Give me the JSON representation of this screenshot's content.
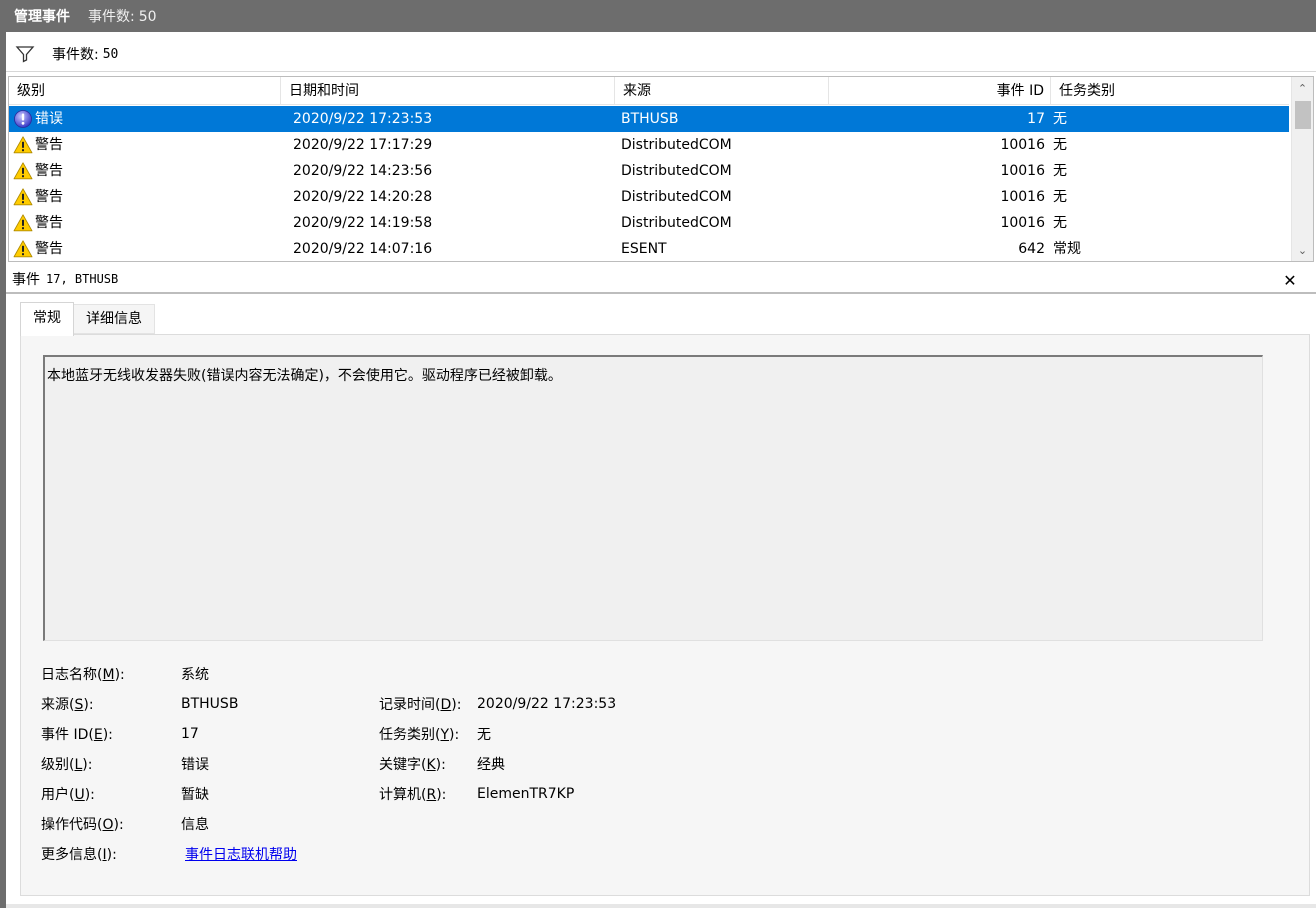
{
  "title": {
    "main": "管理事件",
    "count_label": "事件数:",
    "count_value": "50"
  },
  "filter": {
    "count_label": "事件数:",
    "count_value": "50"
  },
  "columns": {
    "level": "级别",
    "datetime": "日期和时间",
    "source": "来源",
    "event_id": "事件 ID",
    "task": "任务类别"
  },
  "events": [
    {
      "level": "错误",
      "icon": "error-icon",
      "datetime": "2020/9/22 17:23:53",
      "source": "BTHUSB",
      "event_id": "17",
      "task": "无",
      "selected": true
    },
    {
      "level": "警告",
      "icon": "warning-icon",
      "datetime": "2020/9/22 17:17:29",
      "source": "DistributedCOM",
      "event_id": "10016",
      "task": "无"
    },
    {
      "level": "警告",
      "icon": "warning-icon",
      "datetime": "2020/9/22 14:23:56",
      "source": "DistributedCOM",
      "event_id": "10016",
      "task": "无"
    },
    {
      "level": "警告",
      "icon": "warning-icon",
      "datetime": "2020/9/22 14:20:28",
      "source": "DistributedCOM",
      "event_id": "10016",
      "task": "无"
    },
    {
      "level": "警告",
      "icon": "warning-icon",
      "datetime": "2020/9/22 14:19:58",
      "source": "DistributedCOM",
      "event_id": "10016",
      "task": "无"
    },
    {
      "level": "警告",
      "icon": "warning-icon",
      "datetime": "2020/9/22 14:07:16",
      "source": "ESENT",
      "event_id": "642",
      "task": "常规"
    }
  ],
  "detail": {
    "header_label": "事件",
    "header_id": "17, BTHUSB",
    "tabs": [
      "常规",
      "详细信息"
    ],
    "description": "本地蓝牙无线收发器失败(错误内容无法确定)，不会使用它。驱动程序已经被卸载。",
    "log_name_label": "日志名称(",
    "log_name_key": "M",
    "log_name_value": "系统",
    "source_label": "来源(",
    "source_key": "S",
    "source_value": "BTHUSB",
    "logged_label": "记录时间(",
    "logged_key": "D",
    "logged_value": "2020/9/22 17:23:53",
    "event_id_label": "事件 ID(",
    "event_id_key": "E",
    "event_id_value": "17",
    "task_label": "任务类别(",
    "task_key": "Y",
    "task_value": "无",
    "level_label": "级别(",
    "level_key": "L",
    "level_value": "错误",
    "keywords_label": "关键字(",
    "keywords_key": "K",
    "keywords_value": "经典",
    "user_label": "用户(",
    "user_key": "U",
    "user_value": "暂缺",
    "computer_label": "计算机(",
    "computer_key": "R",
    "computer_value": "ElemenTR7KP",
    "opcode_label": "操作代码(",
    "opcode_key": "O",
    "opcode_value": "信息",
    "more_label": "更多信息(",
    "more_key": "I",
    "more_link": "事件日志联机帮助",
    "close_paren": "):"
  },
  "colors": {
    "selection": "#0078d7",
    "titlebar": "#6d6d6d",
    "link": "#0000ee"
  }
}
